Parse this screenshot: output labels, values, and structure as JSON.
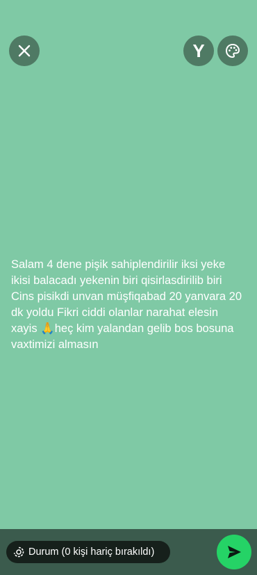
{
  "header": {
    "close_icon": "close-icon",
    "font_button_label": "Y",
    "palette_icon": "palette-icon"
  },
  "status": {
    "text": "Salam 4 dene pişik sahiplendirilir iksi yeke ikisi balacadı yekenin biri qisirlasdirilib biri Cins pisikdi unvan müşfiqabad 20 yanvara 20 dk yoldu Fikri ciddi olanlar narahat elesin xayis 🙏heç kim yalandan gelib bos bosuna vaxtimizi almasın",
    "background_color": "#7fc9a5"
  },
  "footer": {
    "audience_label": "Durum (0 kişi hariç bırakıldı)",
    "audience_icon": "status-ring-icon",
    "send_icon": "send-icon",
    "send_color": "#25d366"
  }
}
